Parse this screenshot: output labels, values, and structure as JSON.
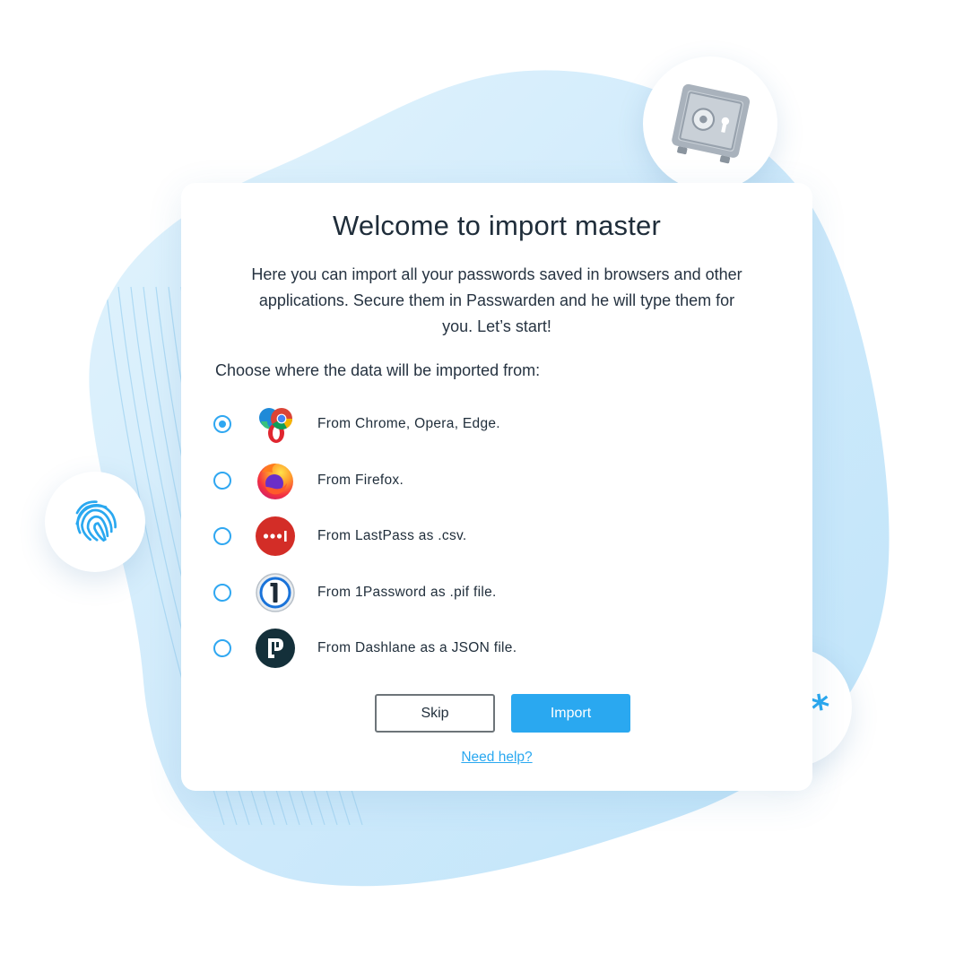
{
  "dialog": {
    "title": "Welcome to import master",
    "description_lines": [
      "Here you can import all your passwords saved in browsers and other",
      "applications. Secure them in Passwarden and he will type them for",
      "you. Let’s start!"
    ],
    "choose_label": "Choose where the data will be imported from:",
    "options": [
      {
        "label": "From Chrome, Opera, Edge.",
        "icon": "chrome-opera-edge-icon",
        "selected": true
      },
      {
        "label": "From Firefox.",
        "icon": "firefox-icon",
        "selected": false
      },
      {
        "label": "From LastPass as .csv.",
        "icon": "lastpass-icon",
        "selected": false
      },
      {
        "label": "From 1Password as .pif file.",
        "icon": "1password-icon",
        "selected": false
      },
      {
        "label": "From Dashlane as a JSON file.",
        "icon": "dashlane-icon",
        "selected": false
      }
    ],
    "skip_label": "Skip",
    "import_label": "Import",
    "help_link": "Need help?"
  },
  "decorations": {
    "safe_icon": "safe-icon",
    "fingerprint_icon": "fingerprint-icon",
    "stars_text": "****"
  },
  "colors": {
    "accent": "#2aa8f0",
    "blob": "#c9e9fb",
    "text": "#1f2d3a"
  }
}
